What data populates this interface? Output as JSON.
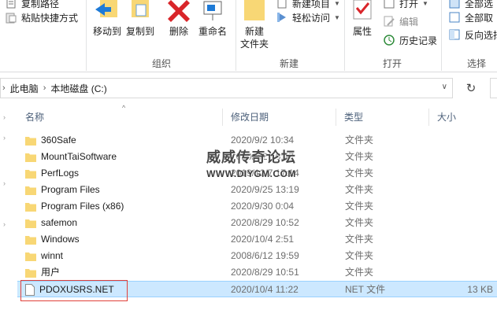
{
  "ribbon": {
    "clipboard": {
      "copy_path_label": "复制路径",
      "paste_shortcut_label": "粘贴快捷方式"
    },
    "organize": {
      "move_to_label": "移动到",
      "copy_to_label": "复制到",
      "delete_label": "删除",
      "rename_label": "重命名",
      "group_label": "组织"
    },
    "new": {
      "new_folder_label": "新建\n文件夹",
      "new_item_label": "新建项目",
      "easy_access_label": "轻松访问",
      "group_label": "新建"
    },
    "open": {
      "properties_label": "属性",
      "open_label": "打开",
      "edit_label": "编辑",
      "history_label": "历史记录",
      "group_label": "打开"
    },
    "select": {
      "select_all_label": "全部选",
      "select_none_label": "全部取",
      "invert_label": "反向选择",
      "group_label": "选择"
    }
  },
  "address": {
    "crumbs": [
      "此电脑",
      "本地磁盘 (C:)"
    ],
    "refresh_icon": "refresh-icon"
  },
  "columns": {
    "name": "名称",
    "date": "修改日期",
    "type": "类型",
    "size": "大小"
  },
  "files": [
    {
      "name": "360Safe",
      "date": "2020/9/2 10:34",
      "type": "文件夹",
      "size": "",
      "kind": "folder"
    },
    {
      "name": "MountTaiSoftware",
      "date": "2020/9/2 10:47",
      "type": "文件夹",
      "size": "",
      "kind": "folder"
    },
    {
      "name": "PerfLogs",
      "date": "2019/12/7 17:14",
      "type": "文件夹",
      "size": "",
      "kind": "folder"
    },
    {
      "name": "Program Files",
      "date": "2020/9/25 13:19",
      "type": "文件夹",
      "size": "",
      "kind": "folder"
    },
    {
      "name": "Program Files (x86)",
      "date": "2020/9/30 0:04",
      "type": "文件夹",
      "size": "",
      "kind": "folder"
    },
    {
      "name": "safemon",
      "date": "2020/8/29 10:52",
      "type": "文件夹",
      "size": "",
      "kind": "folder"
    },
    {
      "name": "Windows",
      "date": "2020/10/4 2:51",
      "type": "文件夹",
      "size": "",
      "kind": "folder"
    },
    {
      "name": "winnt",
      "date": "2008/6/12 19:59",
      "type": "文件夹",
      "size": "",
      "kind": "folder"
    },
    {
      "name": "用户",
      "date": "2020/8/29 10:51",
      "type": "文件夹",
      "size": "",
      "kind": "folder"
    },
    {
      "name": "PDOXUSRS.NET",
      "date": "2020/10/4 11:22",
      "type": "NET 文件",
      "size": "13 KB",
      "kind": "file",
      "selected": true
    }
  ],
  "watermark": {
    "line1": "威威传奇论坛",
    "line2": "WWW.DIYGM.COM"
  },
  "colors": {
    "selection_fill": "#cce8ff",
    "selection_border": "#99d1ff",
    "highlight_outline": "#e0403a",
    "folder": "#f8d775",
    "header_text": "#4c607a"
  }
}
